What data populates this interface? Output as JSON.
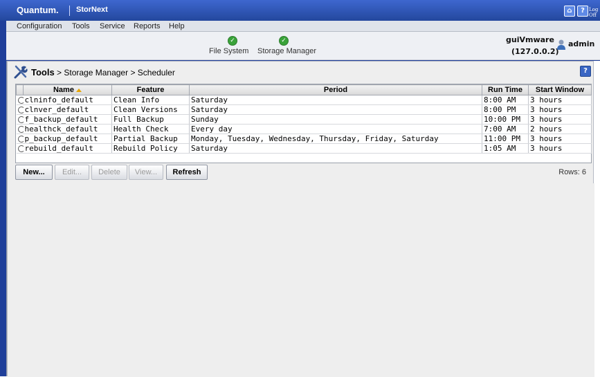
{
  "brand": {
    "logo": "Quantum.",
    "product": "StorNext"
  },
  "topbar": {
    "home_icon": "home-icon",
    "help_icon": "help-icon",
    "logoff_label": "Log Off"
  },
  "menu": [
    "Configuration",
    "Tools",
    "Service",
    "Reports",
    "Help"
  ],
  "status": {
    "items": [
      {
        "label": "File System",
        "state": "ok",
        "icon": "check-icon"
      },
      {
        "label": "Storage Manager",
        "state": "ok",
        "icon": "check-icon"
      }
    ],
    "host": "guiVmware",
    "host_ip": "(127.0.0.2)",
    "user": "admin"
  },
  "breadcrumb": {
    "root": "Tools",
    "path": " > Storage Manager > Scheduler"
  },
  "table": {
    "columns": [
      "Name",
      "Feature",
      "Period",
      "Run Time",
      "Start Window"
    ],
    "sort_column": "Name",
    "rows": [
      [
        "clninfo_default",
        "Clean Info",
        "Saturday",
        "8:00 AM",
        "3 hours"
      ],
      [
        "clnver_default",
        "Clean Versions",
        "Saturday",
        "8:00 PM",
        "3 hours"
      ],
      [
        "f_backup_default",
        "Full Backup",
        "Sunday",
        "10:00 PM",
        "3 hours"
      ],
      [
        "healthck_default",
        "Health Check",
        "Every day",
        "7:00 AM",
        "2 hours"
      ],
      [
        "p_backup_default",
        "Partial Backup",
        "Monday, Tuesday, Wednesday, Thursday, Friday, Saturday",
        "11:00 PM",
        "3 hours"
      ],
      [
        "rebuild_default",
        "Rebuild Policy",
        "Saturday",
        "1:05 AM",
        "3 hours"
      ]
    ]
  },
  "buttons": {
    "new": "New...",
    "edit": "Edit...",
    "delete": "Delete",
    "view": "View...",
    "refresh": "Refresh"
  },
  "rows_count": "Rows: 6",
  "colors": {
    "titlebar": "#23479d",
    "accent": "#3aa33a"
  }
}
